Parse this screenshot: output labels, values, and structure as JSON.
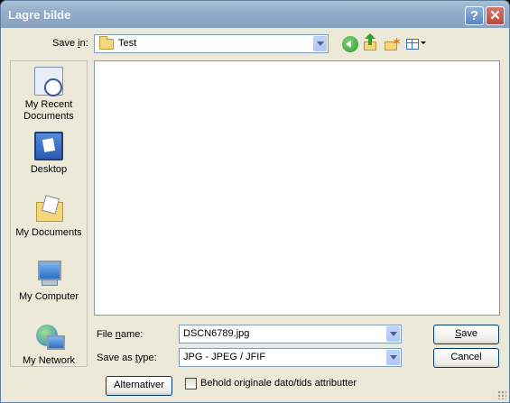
{
  "window": {
    "title": "Lagre bilde"
  },
  "title_buttons": {
    "help": "?",
    "close": "✕"
  },
  "save_in": {
    "label_pre": "Save ",
    "label_key": "i",
    "label_post": "n:",
    "value": "Test"
  },
  "toolbar_icons": [
    "back-icon",
    "up-folder-icon",
    "new-folder-icon",
    "views-menu-icon"
  ],
  "places": [
    {
      "label_line1": "My Recent",
      "label_line2": "Documents",
      "icon": "recent-documents-icon"
    },
    {
      "label_line1": "Desktop",
      "label_line2": "",
      "icon": "desktop-icon"
    },
    {
      "label_line1": "My Documents",
      "label_line2": "",
      "icon": "my-documents-icon"
    },
    {
      "label_line1": "My Computer",
      "label_line2": "",
      "icon": "my-computer-icon"
    },
    {
      "label_line1": "My Network",
      "label_line2": "",
      "icon": "my-network-icon"
    }
  ],
  "file_name": {
    "label_pre": "File ",
    "label_key": "n",
    "label_post": "ame:",
    "value": "DSCN6789.jpg"
  },
  "save_as_type": {
    "label_pre": "Save as ",
    "label_key": "t",
    "label_post": "ype:",
    "value": "JPG - JPEG / JFIF"
  },
  "buttons": {
    "save_key": "S",
    "save_rest": "ave",
    "cancel": "Cancel",
    "options": "Alternativer"
  },
  "checkbox": {
    "label": "Behold originale dato/tids attributter",
    "checked": false
  },
  "colors": {
    "title_bar": "#94aec9",
    "dialog_bg": "#ece9d8",
    "border": "#7f9db9"
  }
}
